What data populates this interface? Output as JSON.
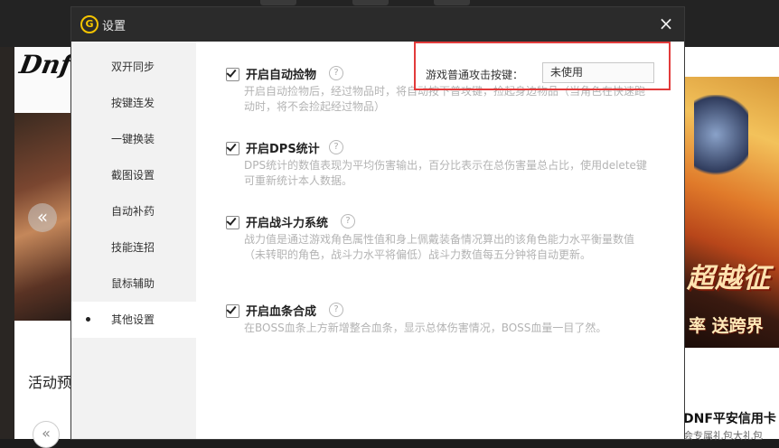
{
  "background": {
    "logo_text": "Dnf",
    "activity_label": "活动预",
    "promo_line1": "超越征",
    "promo_line2": "率 送跨界",
    "news_title": "DNF平安信用卡",
    "news_sub": "会专属礼包大礼包"
  },
  "dialog": {
    "title": "设置",
    "close_glyph": "×",
    "logo_glyph": "G"
  },
  "sidebar": {
    "items": [
      {
        "label": "双开同步",
        "active": false
      },
      {
        "label": "按键连发",
        "active": false
      },
      {
        "label": "一键换装",
        "active": false
      },
      {
        "label": "截图设置",
        "active": false
      },
      {
        "label": "自动补药",
        "active": false
      },
      {
        "label": "技能连招",
        "active": false
      },
      {
        "label": "鼠标辅助",
        "active": false
      },
      {
        "label": "其他设置",
        "active": true
      }
    ]
  },
  "options": [
    {
      "label": "开启自动捡物",
      "checked": true,
      "help": "?",
      "desc": "开启自动捡物后，经过物品时，将自动按下普攻键，捡起身边物品（当角色在快速跑动时，将不会捡起经过物品）"
    },
    {
      "label": "开启DPS统计",
      "checked": true,
      "help": "?",
      "desc": "DPS统计的数值表现为平均伤害输出，百分比表示在总伤害量总占比，使用delete键可重新统计本人数据。"
    },
    {
      "label": "开启战斗力系统",
      "checked": true,
      "help": "?",
      "desc": "战力值是通过游戏角色属性值和身上佩戴装备情况算出的该角色能力水平衡量数值（未转职的角色，战斗力水平将偏低）战斗力数值每五分钟将自动更新。"
    },
    {
      "label": "开启血条合成",
      "checked": true,
      "help": "?",
      "desc": "在BOSS血条上方新增整合血条，显示总体伤害情况，BOSS血量一目了然。"
    }
  ],
  "hotkey": {
    "label": "游戏普通攻击按键：",
    "value": "未使用",
    "highlight_color": "#e23b3b"
  },
  "colors": {
    "titlebar": "#2b2b2b",
    "sidebar": "#f2f2f2",
    "accent": "#f5c400",
    "description": "#b3b3b3"
  }
}
